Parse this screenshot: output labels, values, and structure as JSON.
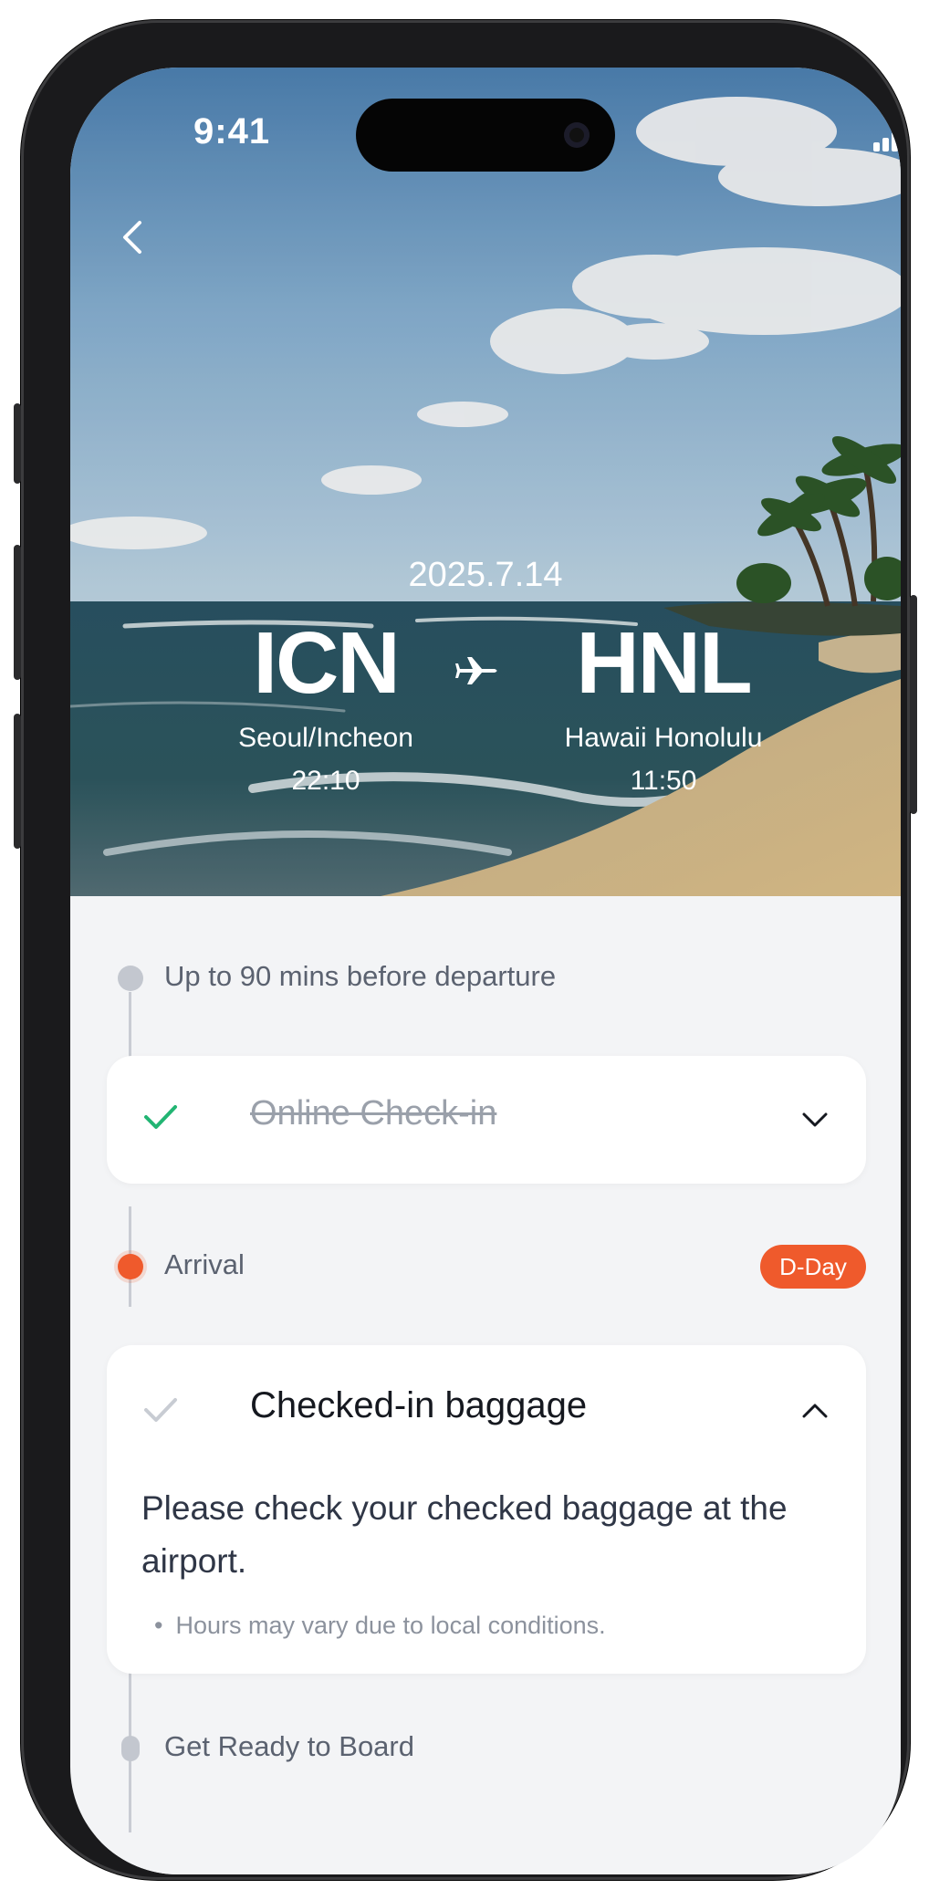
{
  "status_bar": {
    "time": "9:41"
  },
  "flight": {
    "date": "2025.7.14",
    "departure": {
      "code": "ICN",
      "city": "Seoul/Incheon",
      "time": "22:10"
    },
    "arrival": {
      "code": "HNL",
      "city": "Hawaii Honolulu",
      "time": "11:50"
    }
  },
  "timeline": {
    "steps": [
      {
        "label": "Up to 90 mins before departure",
        "state": "past"
      },
      {
        "label": "Arrival",
        "state": "current",
        "badge": "D-Day"
      },
      {
        "label": "Get Ready to Board",
        "state": "upcoming"
      }
    ],
    "cards": {
      "online_checkin": {
        "title": "Online Check-in",
        "done": true,
        "expanded": false
      },
      "baggage": {
        "title": "Checked-in baggage",
        "done": false,
        "expanded": true,
        "body": "Please check your checked baggage at the airport.",
        "note": "Hours may vary due to local conditions."
      }
    }
  },
  "colors": {
    "accent": "#ef5a2c",
    "check_green": "#22b573",
    "timeline_gray": "#c3c7cf",
    "background": "#f3f4f6"
  },
  "icons": [
    "back-arrow-icon",
    "airplane-icon",
    "checkmark-icon",
    "chevron-down-icon",
    "chevron-up-icon",
    "signal-icon",
    "wifi-icon",
    "battery-icon"
  ]
}
